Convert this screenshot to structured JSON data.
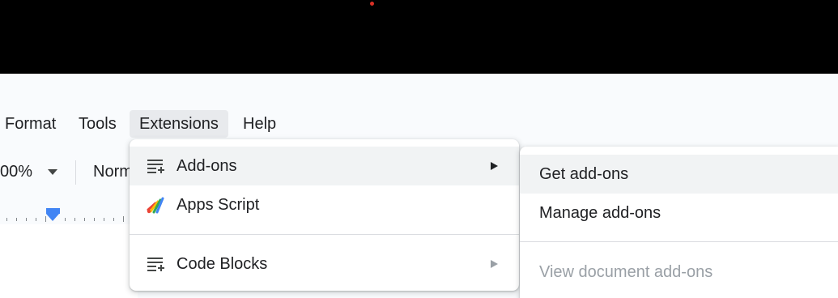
{
  "menubar": {
    "format": "Format",
    "tools": "Tools",
    "extensions": "Extensions",
    "help": "Help"
  },
  "toolbar": {
    "zoom": "00%",
    "style": "Norm"
  },
  "extensions_menu": {
    "items": [
      {
        "label": "Add-ons",
        "icon": "addons-list-icon",
        "has_submenu": true,
        "highlighted": true
      },
      {
        "label": "Apps Script",
        "icon": "apps-script-icon",
        "has_submenu": false
      },
      {
        "label": "Code Blocks",
        "icon": "addons-list-icon",
        "has_submenu": true
      }
    ]
  },
  "addons_submenu": {
    "items": [
      {
        "label": "Get add-ons",
        "highlighted": true,
        "enabled": true
      },
      {
        "label": "Manage add-ons",
        "enabled": true
      },
      {
        "label": "View document add-ons",
        "enabled": false
      }
    ]
  },
  "colors": {
    "menu_highlight": "#f1f3f4",
    "ruler_marker": "#4285f4",
    "disabled_text": "#9aa0a6"
  }
}
